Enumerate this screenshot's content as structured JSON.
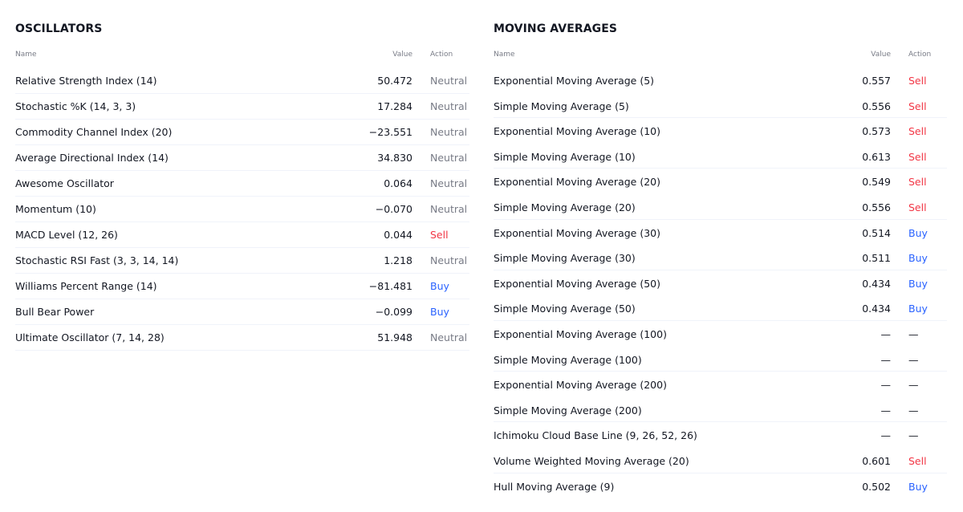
{
  "oscillators": {
    "title": "OSCILLATORS",
    "headers": {
      "name": "Name",
      "value": "Value",
      "action": "Action"
    },
    "rows": [
      {
        "name": "Relative Strength Index (14)",
        "value": "50.472",
        "action": "Neutral"
      },
      {
        "name": "Stochastic %K (14, 3, 3)",
        "value": "17.284",
        "action": "Neutral"
      },
      {
        "name": "Commodity Channel Index (20)",
        "value": "−23.551",
        "action": "Neutral"
      },
      {
        "name": "Average Directional Index (14)",
        "value": "34.830",
        "action": "Neutral"
      },
      {
        "name": "Awesome Oscillator",
        "value": "0.064",
        "action": "Neutral"
      },
      {
        "name": "Momentum (10)",
        "value": "−0.070",
        "action": "Neutral"
      },
      {
        "name": "MACD Level (12, 26)",
        "value": "0.044",
        "action": "Sell"
      },
      {
        "name": "Stochastic RSI Fast (3, 3, 14, 14)",
        "value": "1.218",
        "action": "Neutral"
      },
      {
        "name": "Williams Percent Range (14)",
        "value": "−81.481",
        "action": "Buy"
      },
      {
        "name": "Bull Bear Power",
        "value": "−0.099",
        "action": "Buy"
      },
      {
        "name": "Ultimate Oscillator (7, 14, 28)",
        "value": "51.948",
        "action": "Neutral"
      }
    ]
  },
  "moving_averages": {
    "title": "MOVING AVERAGES",
    "headers": {
      "name": "Name",
      "value": "Value",
      "action": "Action"
    },
    "rows": [
      {
        "name": "Exponential Moving Average (5)",
        "value": "0.557",
        "action": "Sell"
      },
      {
        "name": "Simple Moving Average (5)",
        "value": "0.556",
        "action": "Sell"
      },
      {
        "name": "Exponential Moving Average (10)",
        "value": "0.573",
        "action": "Sell"
      },
      {
        "name": "Simple Moving Average (10)",
        "value": "0.613",
        "action": "Sell"
      },
      {
        "name": "Exponential Moving Average (20)",
        "value": "0.549",
        "action": "Sell"
      },
      {
        "name": "Simple Moving Average (20)",
        "value": "0.556",
        "action": "Sell"
      },
      {
        "name": "Exponential Moving Average (30)",
        "value": "0.514",
        "action": "Buy"
      },
      {
        "name": "Simple Moving Average (30)",
        "value": "0.511",
        "action": "Buy"
      },
      {
        "name": "Exponential Moving Average (50)",
        "value": "0.434",
        "action": "Buy"
      },
      {
        "name": "Simple Moving Average (50)",
        "value": "0.434",
        "action": "Buy"
      },
      {
        "name": "Exponential Moving Average (100)",
        "value": "—",
        "action": "—"
      },
      {
        "name": "Simple Moving Average (100)",
        "value": "—",
        "action": "—"
      },
      {
        "name": "Exponential Moving Average (200)",
        "value": "—",
        "action": "—"
      },
      {
        "name": "Simple Moving Average (200)",
        "value": "—",
        "action": "—"
      },
      {
        "name": "Ichimoku Cloud Base Line (9, 26, 52, 26)",
        "value": "—",
        "action": "—"
      },
      {
        "name": "Volume Weighted Moving Average (20)",
        "value": "0.601",
        "action": "Sell"
      },
      {
        "name": "Hull Moving Average (9)",
        "value": "0.502",
        "action": "Buy"
      }
    ]
  },
  "colors": {
    "text": "#131722",
    "muted": "#787b86",
    "sell": "#f23645",
    "buy": "#2962ff",
    "divider": "#f0f3fa"
  }
}
